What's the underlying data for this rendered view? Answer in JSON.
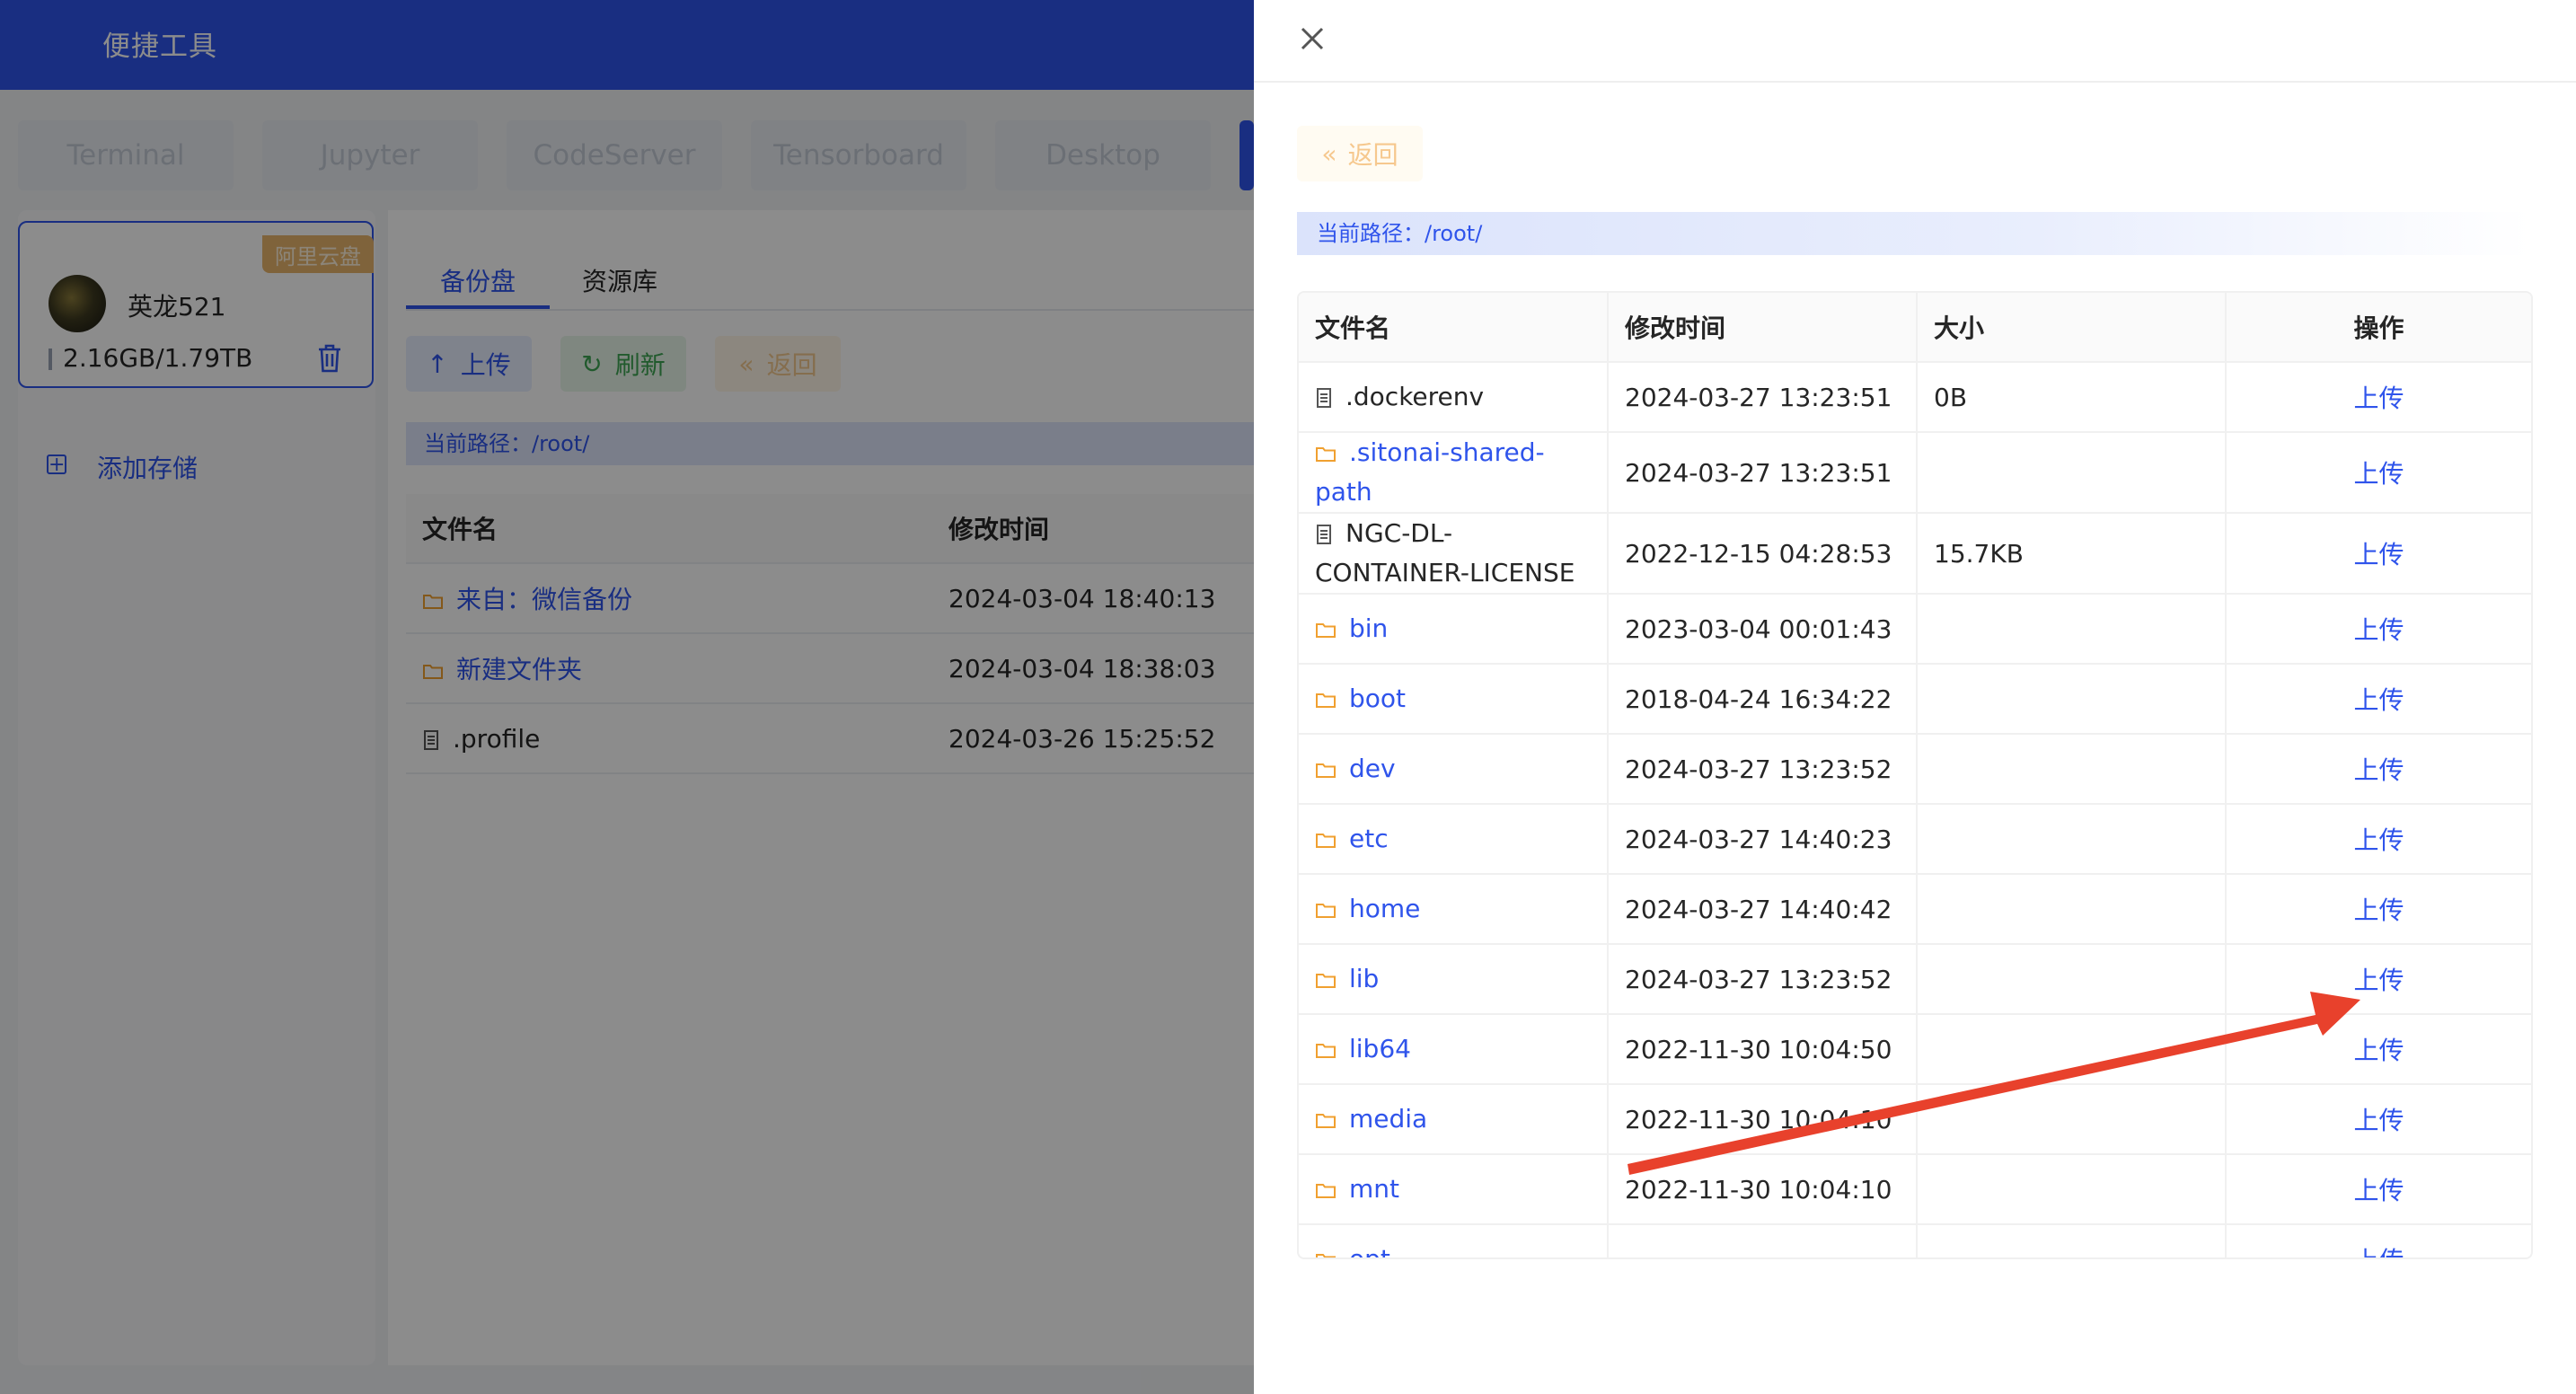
{
  "app": {
    "title": "便捷工具"
  },
  "tools": [
    "Terminal",
    "Jupyter",
    "CodeServer",
    "Tensorboard",
    "Desktop"
  ],
  "storage": {
    "badge": "阿里云盘",
    "user_name": "英龙521",
    "quota": "2.16GB/1.79TB",
    "add_label": "添加存储"
  },
  "main": {
    "tabs": [
      "备份盘",
      "资源库"
    ],
    "upload_label": "上传",
    "refresh_label": "刷新",
    "back_label": "返回",
    "path_label": "当前路径：/root/",
    "columns": [
      "文件名",
      "修改时间"
    ],
    "rows": [
      {
        "name": "来自：微信备份",
        "mtime": "2024-03-04 18:40:13",
        "type": "folder"
      },
      {
        "name": "新建文件夹",
        "mtime": "2024-03-04 18:38:03",
        "type": "folder"
      },
      {
        "name": ".profile",
        "mtime": "2024-03-26 15:25:52",
        "type": "file"
      }
    ]
  },
  "drawer": {
    "back_label": "返回",
    "path_label": "当前路径：/root/",
    "columns": [
      "文件名",
      "修改时间",
      "大小",
      "操作"
    ],
    "action_label": "上传",
    "rows": [
      {
        "name": ".dockerenv",
        "mtime": "2024-03-27 13:23:51",
        "size": "0B",
        "type": "file"
      },
      {
        "name": ".sitonai-shared-path",
        "mtime": "2024-03-27 13:23:51",
        "size": "",
        "type": "folder"
      },
      {
        "name": "NGC-DL-CONTAINER-LICENSE",
        "mtime": "2022-12-15 04:28:53",
        "size": "15.7KB",
        "type": "file"
      },
      {
        "name": "bin",
        "mtime": "2023-03-04 00:01:43",
        "size": "",
        "type": "folder"
      },
      {
        "name": "boot",
        "mtime": "2018-04-24 16:34:22",
        "size": "",
        "type": "folder"
      },
      {
        "name": "dev",
        "mtime": "2024-03-27 13:23:52",
        "size": "",
        "type": "folder"
      },
      {
        "name": "etc",
        "mtime": "2024-03-27 14:40:23",
        "size": "",
        "type": "folder"
      },
      {
        "name": "home",
        "mtime": "2024-03-27 14:40:42",
        "size": "",
        "type": "folder"
      },
      {
        "name": "lib",
        "mtime": "2024-03-27 13:23:52",
        "size": "",
        "type": "folder"
      },
      {
        "name": "lib64",
        "mtime": "2022-11-30 10:04:50",
        "size": "",
        "type": "folder"
      },
      {
        "name": "media",
        "mtime": "2022-11-30 10:04:10",
        "size": "",
        "type": "folder"
      },
      {
        "name": "mnt",
        "mtime": "2022-11-30 10:04:10",
        "size": "",
        "type": "folder"
      },
      {
        "name": "opt",
        "mtime": "",
        "size": "",
        "type": "folder"
      }
    ]
  },
  "colors": {
    "primary": "#2f54eb",
    "folder": "#f0a030",
    "annotation_arrow": "#e8412c"
  }
}
